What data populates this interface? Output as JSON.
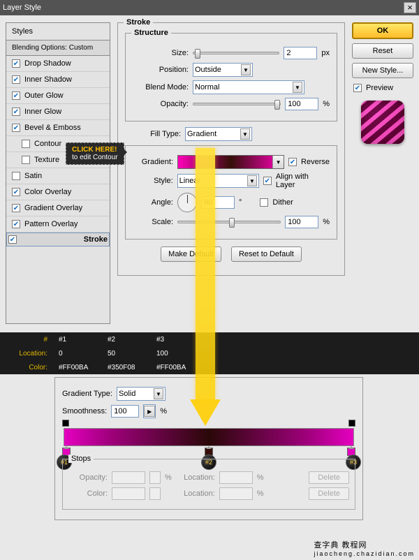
{
  "title": "Layer Style",
  "styles_header": "Styles",
  "blending_options": "Blending Options: Custom",
  "style_items": [
    {
      "label": "Drop Shadow",
      "checked": true
    },
    {
      "label": "Inner Shadow",
      "checked": true
    },
    {
      "label": "Outer Glow",
      "checked": true
    },
    {
      "label": "Inner Glow",
      "checked": true
    },
    {
      "label": "Bevel & Emboss",
      "checked": true
    },
    {
      "label": "Contour",
      "checked": false,
      "sub": true
    },
    {
      "label": "Texture",
      "checked": false,
      "sub": true
    },
    {
      "label": "Satin",
      "checked": false
    },
    {
      "label": "Color Overlay",
      "checked": true
    },
    {
      "label": "Gradient Overlay",
      "checked": true
    },
    {
      "label": "Pattern Overlay",
      "checked": true
    },
    {
      "label": "Stroke",
      "checked": true,
      "bold": true,
      "sel": true
    }
  ],
  "tooltip": {
    "l1": "CLICK HERE!",
    "l2": "to edit Contour"
  },
  "stroke": {
    "heading": "Stroke",
    "structure": "Structure",
    "size_label": "Size:",
    "size_val": "2",
    "size_unit": "px",
    "position_label": "Position:",
    "position_val": "Outside",
    "blendmode_label": "Blend Mode:",
    "blendmode_val": "Normal",
    "opacity_label": "Opacity:",
    "opacity_val": "100",
    "opacity_unit": "%",
    "filltype_label": "Fill Type:",
    "filltype_val": "Gradient",
    "gradient_label": "Gradient:",
    "reverse_label": "Reverse",
    "style_label": "Style:",
    "style_val": "Linear",
    "align_label": "Align with Layer",
    "angle_label": "Angle:",
    "angle_val": "90",
    "angle_unit": "°",
    "dither_label": "Dither",
    "scale_label": "Scale:",
    "scale_val": "100",
    "scale_unit": "%",
    "make_default": "Make Default",
    "reset_default": "Reset to Default"
  },
  "buttons": {
    "ok": "OK",
    "reset": "Reset",
    "new_style": "New Style...",
    "preview": "Preview"
  },
  "table": {
    "headers": {
      "num": "#",
      "c1": "#1",
      "c2": "#2",
      "c3": "#3"
    },
    "rows": [
      {
        "h": "Location:",
        "c1": "0",
        "c2": "50",
        "c3": "100"
      },
      {
        "h": "Color:",
        "c1": "#FF00BA",
        "c2": "#350F08",
        "c3": "#FF00BA"
      }
    ]
  },
  "grad_editor": {
    "type_label": "Gradient Type:",
    "type_val": "Solid",
    "smooth_label": "Smoothness:",
    "smooth_val": "100",
    "smooth_unit": "%",
    "stops_label": "Stops",
    "opacity_label": "Opacity:",
    "pct": "%",
    "location_label": "Location:",
    "delete": "Delete",
    "color_label": "Color:",
    "badges": {
      "b1": "#1",
      "b2": "#2",
      "b3": "#3"
    }
  },
  "footer": {
    "l1": "查字典 教程网",
    "l2": "jiaocheng.chazidian.com"
  }
}
